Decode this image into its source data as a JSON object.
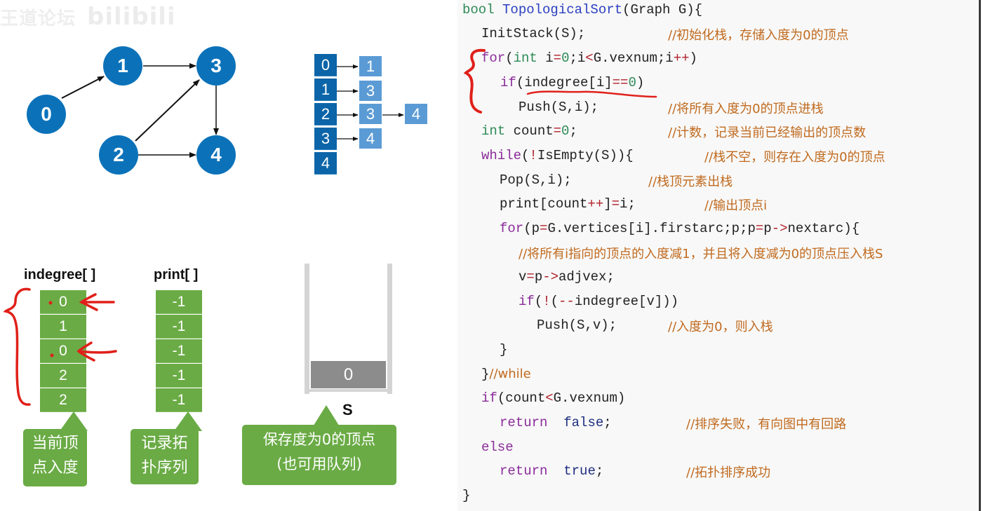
{
  "watermark": {
    "text": "王道论坛",
    "logo": "bilibili"
  },
  "graph": {
    "nodes": [
      "0",
      "1",
      "2",
      "3",
      "4"
    ],
    "edges": [
      [
        "0",
        "1"
      ],
      [
        "1",
        "3"
      ],
      [
        "2",
        "3"
      ],
      [
        "2",
        "4"
      ],
      [
        "3",
        "4"
      ]
    ],
    "node_color": "#0b72b9"
  },
  "adjacency_list": {
    "head": [
      "0",
      "1",
      "2",
      "3",
      "4"
    ],
    "arcs": [
      [
        "1"
      ],
      [
        "3"
      ],
      [
        "3",
        "4"
      ],
      [
        "4"
      ],
      []
    ],
    "head_color": "#0b65a8",
    "arc_color": "#5b9bd5"
  },
  "indegree": {
    "title": "indegree[ ]",
    "values": [
      "0",
      "1",
      "0",
      "2",
      "2"
    ],
    "callout": [
      "当前顶",
      "点入度"
    ]
  },
  "print": {
    "title": "print[ ]",
    "values": [
      "-1",
      "-1",
      "-1",
      "-1",
      "-1"
    ],
    "callout": [
      "记录拓",
      "扑序列"
    ]
  },
  "stack": {
    "label": "S",
    "items": [
      "0"
    ],
    "callout": [
      "保存度为0的顶点",
      "(也可用队列)"
    ]
  },
  "code": {
    "l1": {
      "t": "bool",
      "f": "TopologicalSort",
      "rest": "(Graph G){"
    },
    "l2": {
      "code": "InitStack(S);",
      "comment": "//初始化栈，存储入度为0的顶点"
    },
    "l3": {
      "kw": "for",
      "a": "(",
      "t": "int",
      "b": " i",
      "op1": "=",
      "n1": "0",
      "c": ";i",
      "op2": "<",
      "d": "G.vexnum;i",
      "op3": "++",
      "e": ")"
    },
    "l4": {
      "kw": "if",
      "a": "(indegree[i]",
      "op": "==",
      "n": "0",
      "b": ")"
    },
    "l5": {
      "code": "Push(S,i);",
      "comment": "//将所有入度为0的顶点进栈"
    },
    "l6": {
      "t": "int",
      "a": " count",
      "op": "=",
      "n": "0",
      "b": ";",
      "comment": "//计数，记录当前已经输出的顶点数"
    },
    "l7": {
      "kw": "while",
      "a": "(",
      "op": "!",
      "b": "IsEmpty(S)){",
      "comment": "//栈不空，则存在入度为0的顶点"
    },
    "l8": {
      "code": "Pop(S,i);",
      "comment": "//栈顶元素出栈"
    },
    "l9": {
      "a": "print[count",
      "op1": "++",
      "b": "]",
      "op2": "=",
      "c": "i;",
      "comment": "//输出顶点i"
    },
    "l10": {
      "kw": "for",
      "a": "(p",
      "op1": "=",
      "b": "G.vertices[i].firstarc;p;p",
      "op2": "=",
      "c": "p",
      "op3": "->",
      "d": "nextarc){"
    },
    "l11": {
      "comment": "//将所有i指向的顶点的入度减1，并且将入度减为0的顶点压入栈S"
    },
    "l12": {
      "a": "v",
      "op1": "=",
      "b": "p",
      "op2": "->",
      "c": "adjvex;"
    },
    "l13": {
      "kw": "if",
      "a": "(",
      "op1": "!",
      "b": "(",
      "op2": "--",
      "c": "indegree[v]))"
    },
    "l14": {
      "code": "Push(S,v);",
      "comment": "//入度为0，则入栈"
    },
    "l15": {
      "code": "}"
    },
    "l16": {
      "code": "}",
      "comment": "//while"
    },
    "l17": {
      "kw": "if",
      "a": "(count",
      "op": "<",
      "b": "G.vexnum)"
    },
    "l18": {
      "kw": "return",
      "lit": "false",
      "b": ";",
      "comment": "//排序失败，有向图中有回路"
    },
    "l19": {
      "kw": "else"
    },
    "l20": {
      "kw": "return",
      "lit": "true",
      "b": ";",
      "comment": "//拓扑排序成功"
    },
    "l21": {
      "code": "}"
    }
  },
  "annotation_color": "#e0201a"
}
